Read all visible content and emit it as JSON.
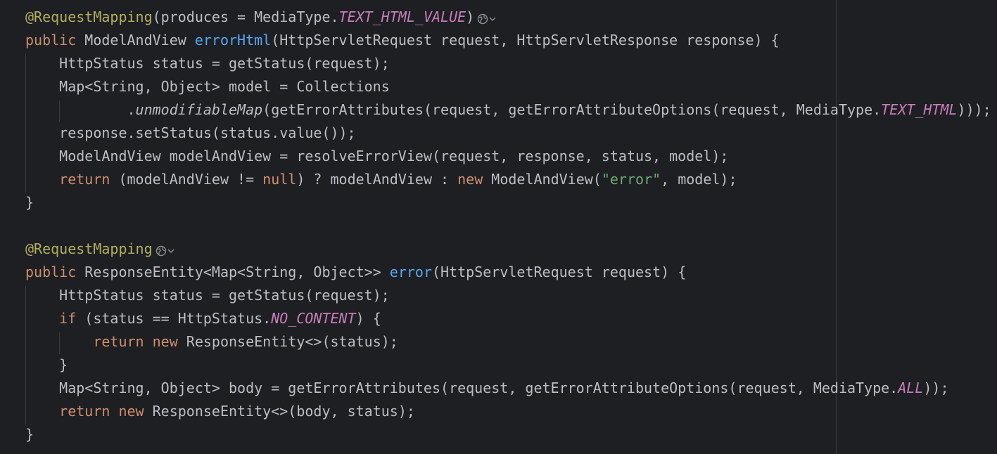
{
  "colors": {
    "background": "#1e1f22",
    "plain": "#bcbec4",
    "keyword": "#cf8e6d",
    "annotation": "#b3ae60",
    "method_declaration": "#56a8f5",
    "constant": "#c77dbb",
    "string": "#6aab73",
    "indent_guide": "#393b40"
  },
  "icons": [
    "globe-icon",
    "chevron-down-icon"
  ],
  "lines": [
    {
      "tokens": [
        {
          "t": "@RequestMapping",
          "c": "ann"
        },
        {
          "t": "(produces = MediaType.",
          "c": "plain"
        },
        {
          "t": "TEXT_HTML_VALUE",
          "c": "const"
        },
        {
          "t": ")",
          "c": "plain"
        }
      ],
      "icons": true
    },
    {
      "tokens": [
        {
          "t": "public ",
          "c": "kw"
        },
        {
          "t": "ModelAndView ",
          "c": "plain"
        },
        {
          "t": "errorHtml",
          "c": "fn"
        },
        {
          "t": "(HttpServletRequest request, HttpServletResponse response) {",
          "c": "plain"
        }
      ]
    },
    {
      "tokens": [
        {
          "t": "    HttpStatus status = getStatus(request);",
          "c": "plain"
        }
      ]
    },
    {
      "tokens": [
        {
          "t": "    Map<String, Object> model = Collections",
          "c": "plain"
        }
      ]
    },
    {
      "tokens": [
        {
          "t": "            .",
          "c": "plain"
        },
        {
          "t": "unmodifiableMap",
          "c": "static"
        },
        {
          "t": "(getErrorAttributes(request, getErrorAttributeOptions(request, MediaType.",
          "c": "plain"
        },
        {
          "t": "TEXT_HTML",
          "c": "const"
        },
        {
          "t": ")));",
          "c": "plain"
        }
      ]
    },
    {
      "tokens": [
        {
          "t": "    response.setStatus(status.value());",
          "c": "plain"
        }
      ]
    },
    {
      "tokens": [
        {
          "t": "    ModelAndView modelAndView = resolveErrorView(request, response, status, model);",
          "c": "plain"
        }
      ]
    },
    {
      "tokens": [
        {
          "t": "    ",
          "c": "plain"
        },
        {
          "t": "return ",
          "c": "kw"
        },
        {
          "t": "(modelAndView != ",
          "c": "plain"
        },
        {
          "t": "null",
          "c": "kw"
        },
        {
          "t": ") ? modelAndView : ",
          "c": "plain"
        },
        {
          "t": "new ",
          "c": "kw"
        },
        {
          "t": "ModelAndView(",
          "c": "plain"
        },
        {
          "t": "\"error\"",
          "c": "str"
        },
        {
          "t": ", model);",
          "c": "plain"
        }
      ]
    },
    {
      "tokens": [
        {
          "t": "}",
          "c": "plain"
        }
      ]
    },
    {
      "tokens": []
    },
    {
      "tokens": [
        {
          "t": "@RequestMapping",
          "c": "ann"
        }
      ],
      "icons": true
    },
    {
      "tokens": [
        {
          "t": "public ",
          "c": "kw"
        },
        {
          "t": "ResponseEntity<Map<String, Object>> ",
          "c": "plain"
        },
        {
          "t": "error",
          "c": "fn"
        },
        {
          "t": "(HttpServletRequest request) {",
          "c": "plain"
        }
      ]
    },
    {
      "tokens": [
        {
          "t": "    HttpStatus status = getStatus(request);",
          "c": "plain"
        }
      ]
    },
    {
      "tokens": [
        {
          "t": "    ",
          "c": "plain"
        },
        {
          "t": "if ",
          "c": "kw"
        },
        {
          "t": "(status == HttpStatus.",
          "c": "plain"
        },
        {
          "t": "NO_CONTENT",
          "c": "const"
        },
        {
          "t": ") {",
          "c": "plain"
        }
      ]
    },
    {
      "tokens": [
        {
          "t": "        ",
          "c": "plain"
        },
        {
          "t": "return ",
          "c": "kw"
        },
        {
          "t": "new ",
          "c": "kw"
        },
        {
          "t": "ResponseEntity<>(status);",
          "c": "plain"
        }
      ]
    },
    {
      "tokens": [
        {
          "t": "    }",
          "c": "plain"
        }
      ]
    },
    {
      "tokens": [
        {
          "t": "    Map<String, Object> body = getErrorAttributes(request, getErrorAttributeOptions(request, MediaType.",
          "c": "plain"
        },
        {
          "t": "ALL",
          "c": "const"
        },
        {
          "t": "));",
          "c": "plain"
        }
      ]
    },
    {
      "tokens": [
        {
          "t": "    ",
          "c": "plain"
        },
        {
          "t": "return ",
          "c": "kw"
        },
        {
          "t": "new ",
          "c": "kw"
        },
        {
          "t": "ResponseEntity<>(body, status);",
          "c": "plain"
        }
      ]
    },
    {
      "tokens": [
        {
          "t": "}",
          "c": "plain"
        }
      ]
    }
  ]
}
